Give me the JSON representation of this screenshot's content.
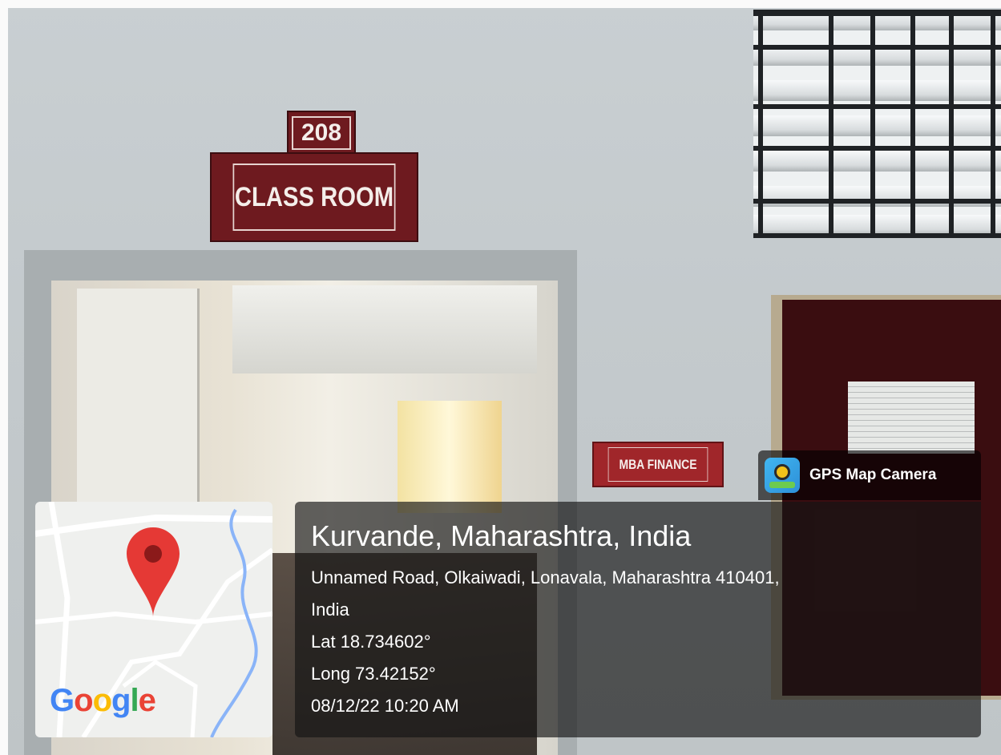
{
  "signs": {
    "room_number": "208",
    "room_label": "CLASS ROOM",
    "department": "MBA FINANCE"
  },
  "overlay": {
    "app_name": "GPS Map Camera",
    "app_icon": "gps-map-camera-icon",
    "place": "Kurvande, Maharashtra, India",
    "address_line1": "Unnamed Road, Olkaiwadi, Lonavala, Maharashtra 410401,",
    "address_line2": "India",
    "latitude": "Lat 18.734602°",
    "longitude": "Long 73.42152°",
    "datetime": "08/12/22 10:20 AM"
  },
  "map": {
    "pin_icon": "map-pin-icon",
    "pin_color": "#e53935",
    "brand": "Google"
  }
}
